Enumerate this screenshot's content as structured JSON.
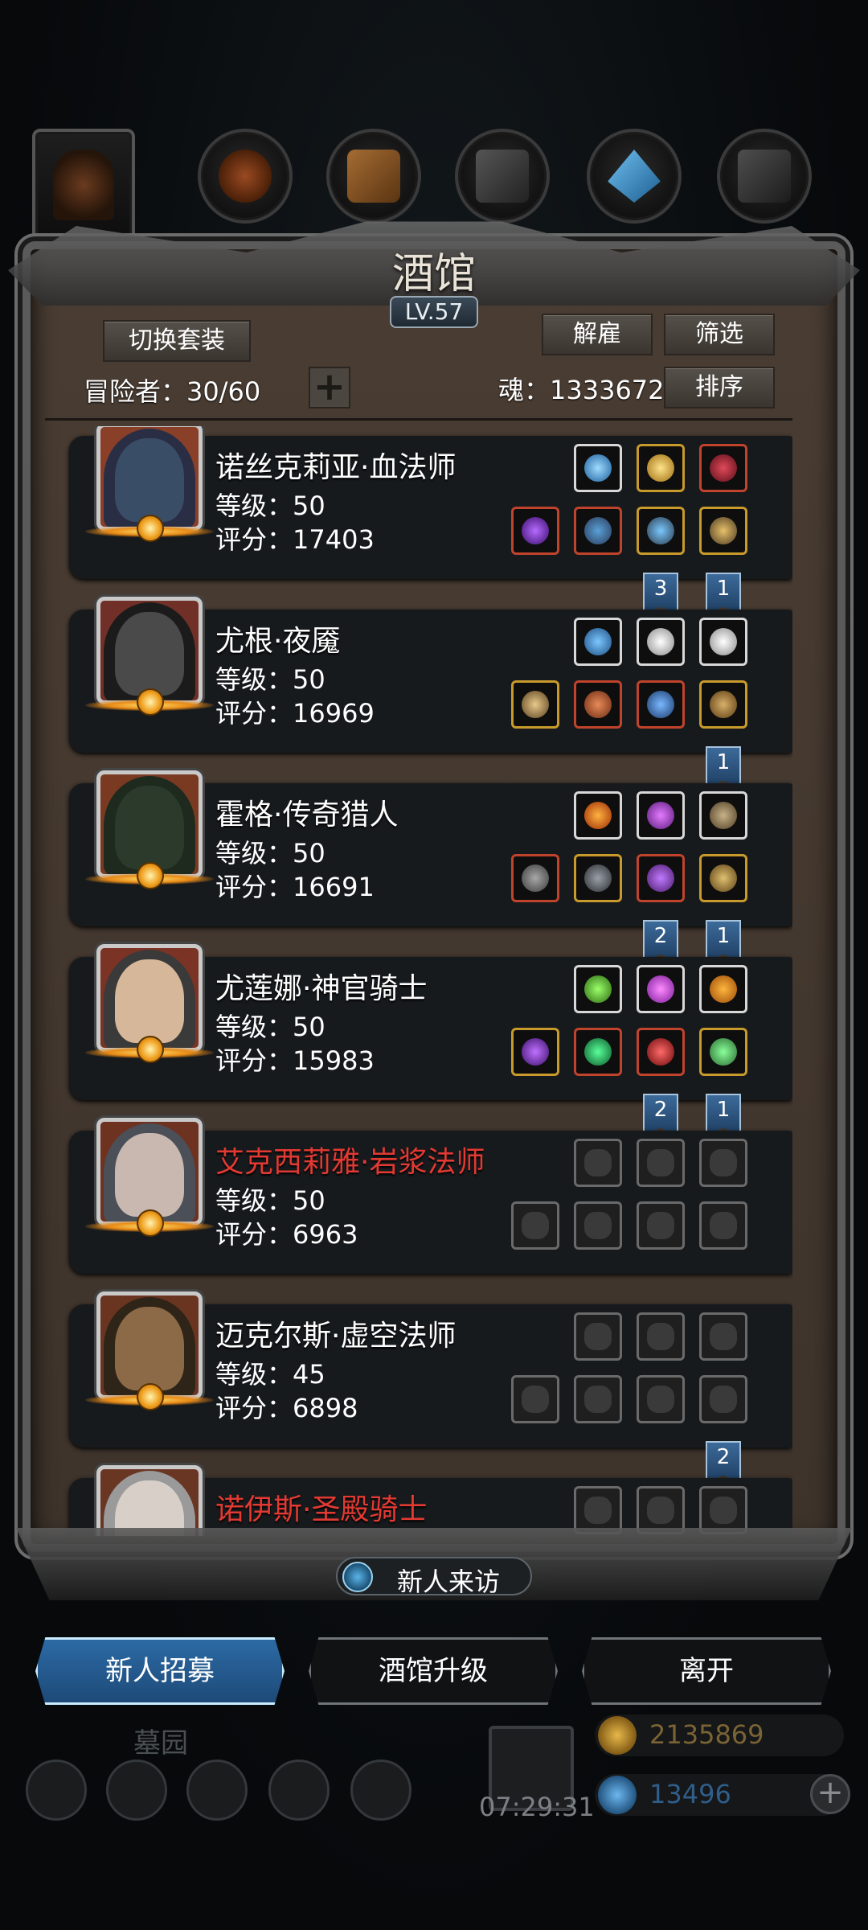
{
  "tavern": {
    "title": "酒馆",
    "level": "LV.57",
    "switch_set_label": "切换套装",
    "dismiss_label": "解雇",
    "filter_label": "筛选",
    "sort_label": "排序",
    "adventurer_count": "冒险者：30/60",
    "souls": "魂：1333672"
  },
  "heroes": [
    {
      "name": "诺丝克莉亚·血法师",
      "level": "等级：50",
      "score": "评分：17403",
      "red": false,
      "badges": [
        "3",
        "1"
      ]
    },
    {
      "name": "尤根·夜魇",
      "level": "等级：50",
      "score": "评分：16969",
      "red": false,
      "badges": [
        "1"
      ]
    },
    {
      "name": "霍格·传奇猎人",
      "level": "等级：50",
      "score": "评分：16691",
      "red": false,
      "badges": [
        "2",
        "1"
      ]
    },
    {
      "name": "尤莲娜·神官骑士",
      "level": "等级：50",
      "score": "评分：15983",
      "red": false,
      "badges": [
        "2",
        "1"
      ]
    },
    {
      "name": "艾克西莉雅·岩浆法师",
      "level": "等级：50",
      "score": "评分：6963",
      "red": true,
      "badges": []
    },
    {
      "name": "迈克尔斯·虚空法师",
      "level": "等级：45",
      "score": "评分：6898",
      "red": false,
      "badges": [
        "2"
      ]
    },
    {
      "name": "诺伊斯·圣殿骑士",
      "level": "",
      "score": "",
      "red": true,
      "badges": []
    }
  ],
  "visitor_label": "新人来访",
  "actions": {
    "recruit": "新人招募",
    "upgrade": "酒馆升级",
    "leave": "离开"
  },
  "footer": {
    "graveyard": "墓园",
    "timer": "07:29:31",
    "gold": "2135869",
    "gems": "13496"
  },
  "colors": {
    "accent_blue": "#2c6aa5",
    "red_name": "#e23a32",
    "gold": "#c9a040",
    "gem_blue": "#3a78b4"
  }
}
